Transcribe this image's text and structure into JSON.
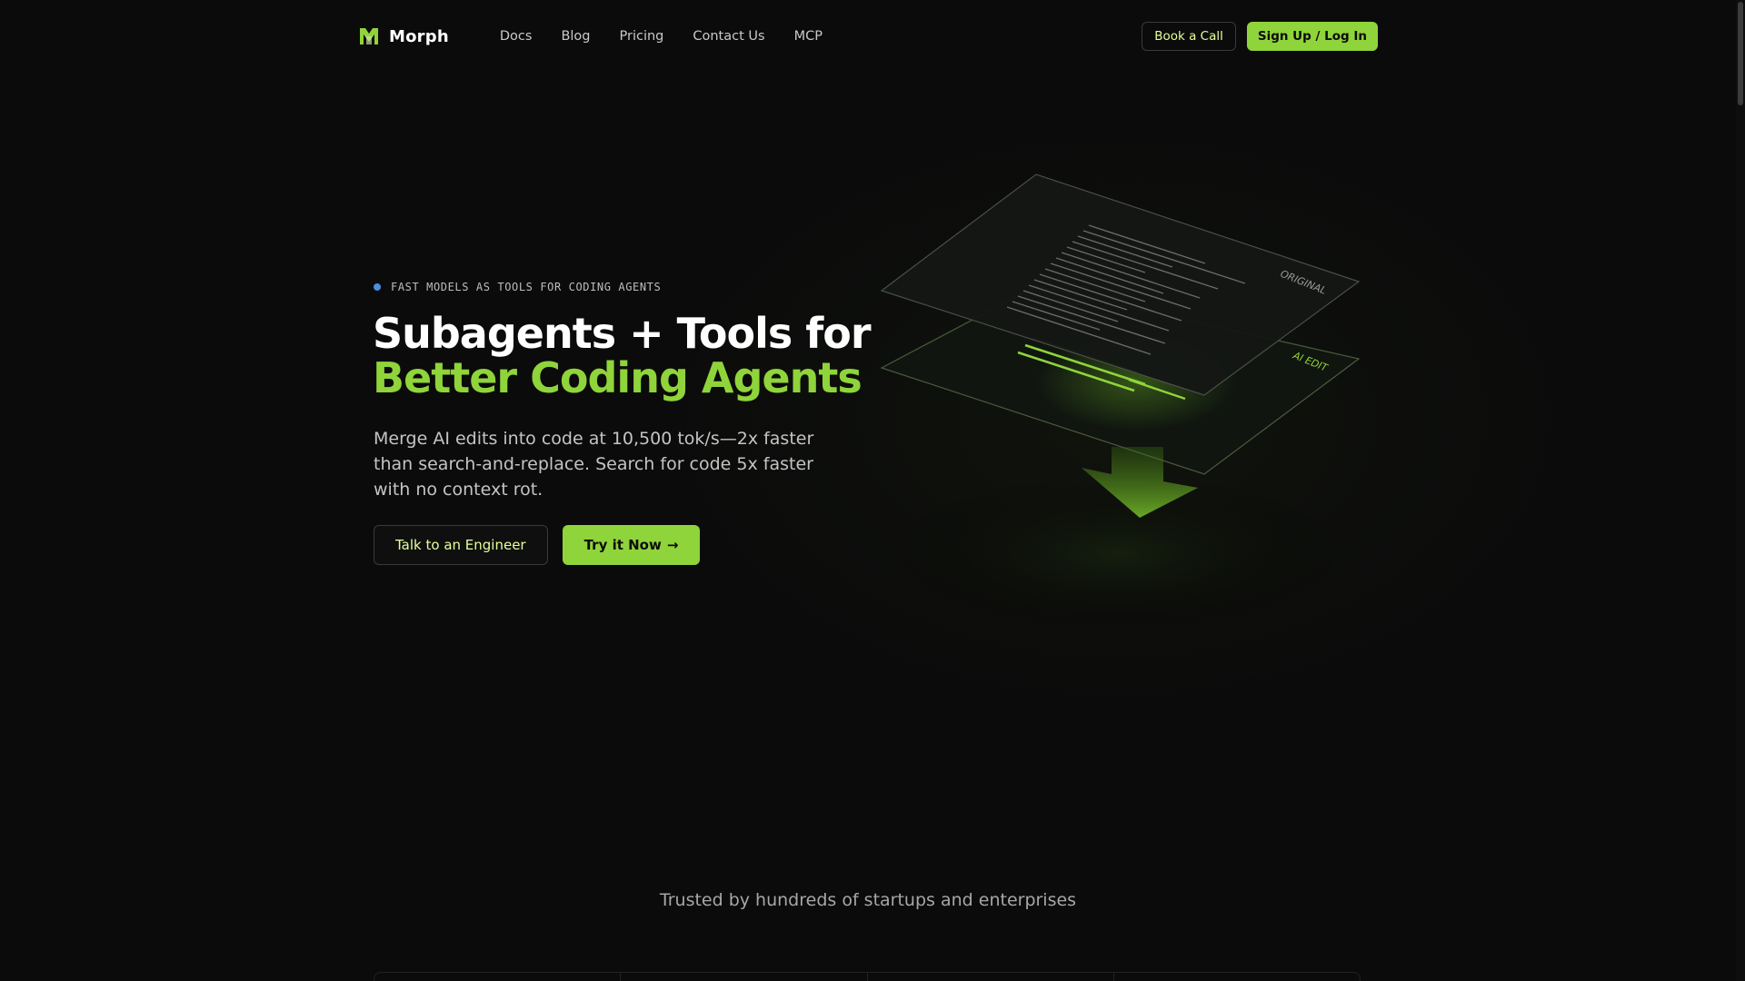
{
  "nav": {
    "brand": "Morph",
    "links": [
      "Docs",
      "Blog",
      "Pricing",
      "Contact Us",
      "MCP"
    ],
    "book_call": "Book a Call",
    "signup": "Sign Up / Log In"
  },
  "hero": {
    "eyebrow": "FAST MODELS AS TOOLS FOR CODING AGENTS",
    "headline_line1": "Subagents + Tools for",
    "headline_line2": "Better Coding Agents",
    "subcopy": "Merge AI edits into code at 10,500 tok/s—2x faster than search-and-replace. Search for code 5x faster with no context rot.",
    "cta_secondary": "Talk to an Engineer",
    "cta_primary": "Try it Now",
    "cta_primary_arrow": "→"
  },
  "illustration": {
    "top_sheet_label": "ORIGINAL",
    "bottom_sheet_label": "AI EDIT"
  },
  "trusted": {
    "text": "Trusted by hundreds of startups and enterprises"
  },
  "colors": {
    "accent": "#8fd43a",
    "accent_text": "#e4ff9a",
    "background": "#0b0b0b",
    "dot": "#4a8ee0"
  },
  "icons": {
    "brand": "morph-logo-icon",
    "arrow": "arrow-right-icon",
    "down": "arrow-down-icon"
  }
}
